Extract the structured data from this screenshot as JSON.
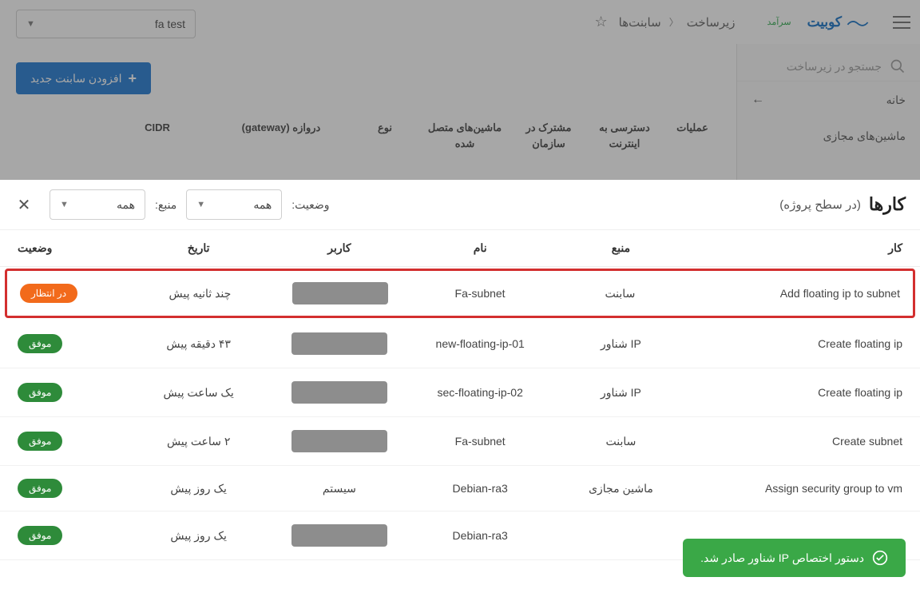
{
  "header": {
    "brand": "کوبیت",
    "sidebrand": "سرآمد",
    "crumb_root": "زیرساخت",
    "crumb_leaf": "سابنت‌ها",
    "project": "fa test"
  },
  "sidebar": {
    "search_placeholder": "جستجو در زیرساخت",
    "home": "خانه",
    "vms": "ماشین‌های مجازی"
  },
  "add_subnet": "افزودن سابنت جدید",
  "subnet_cols": {
    "ops": "عملیات",
    "internet": "دسترسی به اینترنت",
    "shared": "مشترک در سازمان",
    "machines": "ماشین‌های متصل شده",
    "type": "نوع",
    "gateway": "دروازه (gateway)",
    "cidr": "CIDR"
  },
  "tasks": {
    "title": "کارها",
    "scope": "(در سطح پروژه)",
    "status_label": "وضعیت:",
    "source_label": "منبع:",
    "all": "همه",
    "cols": {
      "task": "کار",
      "source": "منبع",
      "name": "نام",
      "user": "کاربر",
      "date": "تاریخ",
      "status": "وضعیت"
    },
    "rows": [
      {
        "task": "Add floating ip to subnet",
        "source": "سابنت",
        "name": "Fa-subnet",
        "user": "_blob",
        "date": "چند ثانیه پیش",
        "status": "pending",
        "status_label": "در انتظار",
        "hl": true
      },
      {
        "task": "Create floating ip",
        "source": "IP شناور",
        "name": "new-floating-ip-01",
        "user": "_blob",
        "date": "۴۳ دقیقه پیش",
        "status": "success",
        "status_label": "موفق"
      },
      {
        "task": "Create floating ip",
        "source": "IP شناور",
        "name": "sec-floating-ip-02",
        "user": "_blob",
        "date": "یک ساعت پیش",
        "status": "success",
        "status_label": "موفق"
      },
      {
        "task": "Create subnet",
        "source": "سابنت",
        "name": "Fa-subnet",
        "user": "_blob",
        "date": "۲ ساعت پیش",
        "status": "success",
        "status_label": "موفق"
      },
      {
        "task": "Assign security group to vm",
        "source": "ماشین مجازی",
        "name": "Debian-ra3",
        "user": "سیستم",
        "date": "یک روز پیش",
        "status": "success",
        "status_label": "موفق"
      },
      {
        "task": "",
        "source": "",
        "name": "Debian-ra3",
        "user": "_blob",
        "date": "یک روز پیش",
        "status": "success",
        "status_label": "موفق"
      }
    ]
  },
  "toast": "دستور اختصاص IP شناور صادر شد."
}
